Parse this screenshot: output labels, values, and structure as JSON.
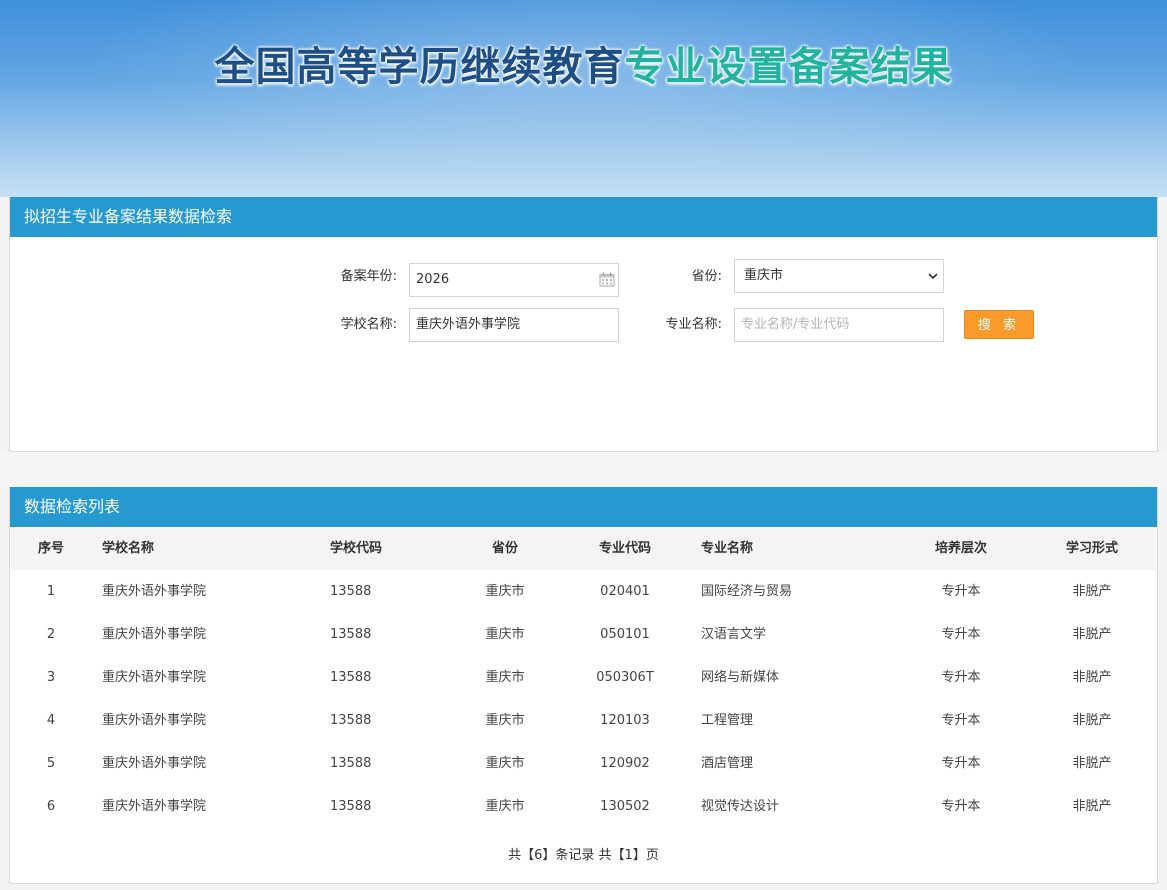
{
  "banner": {
    "title_part1": "全国高等学历继续教育",
    "title_part2": "专业设置备案结果"
  },
  "search_panel": {
    "title": "拟招生专业备案结果数据检索",
    "year_label": "备案年份:",
    "year_value": "2026",
    "province_label": "省份:",
    "province_value": "重庆市",
    "school_label": "学校名称:",
    "school_value": "重庆外语外事学院",
    "major_label": "专业名称:",
    "major_placeholder": "专业名称/专业代码",
    "search_button": "搜 索"
  },
  "list_panel": {
    "title": "数据检索列表",
    "columns": [
      "序号",
      "学校名称",
      "学校代码",
      "省份",
      "专业代码",
      "专业名称",
      "培养层次",
      "学习形式"
    ],
    "rows": [
      [
        "1",
        "重庆外语外事学院",
        "13588",
        "重庆市",
        "020401",
        "国际经济与贸易",
        "专升本",
        "非脱产"
      ],
      [
        "2",
        "重庆外语外事学院",
        "13588",
        "重庆市",
        "050101",
        "汉语言文学",
        "专升本",
        "非脱产"
      ],
      [
        "3",
        "重庆外语外事学院",
        "13588",
        "重庆市",
        "050306T",
        "网络与新媒体",
        "专升本",
        "非脱产"
      ],
      [
        "4",
        "重庆外语外事学院",
        "13588",
        "重庆市",
        "120103",
        "工程管理",
        "专升本",
        "非脱产"
      ],
      [
        "5",
        "重庆外语外事学院",
        "13588",
        "重庆市",
        "120902",
        "酒店管理",
        "专升本",
        "非脱产"
      ],
      [
        "6",
        "重庆外语外事学院",
        "13588",
        "重庆市",
        "130502",
        "视觉传达设计",
        "专升本",
        "非脱产"
      ]
    ],
    "pagination": "共【6】条记录 共【1】页"
  },
  "colors": {
    "header_blue": "#2699d1",
    "button_orange": "#f99a2a",
    "title_dark": "#1d4f86",
    "title_teal": "#21b3a0"
  },
  "icons": [
    "calendar-icon",
    "chevron-down-icon"
  ]
}
